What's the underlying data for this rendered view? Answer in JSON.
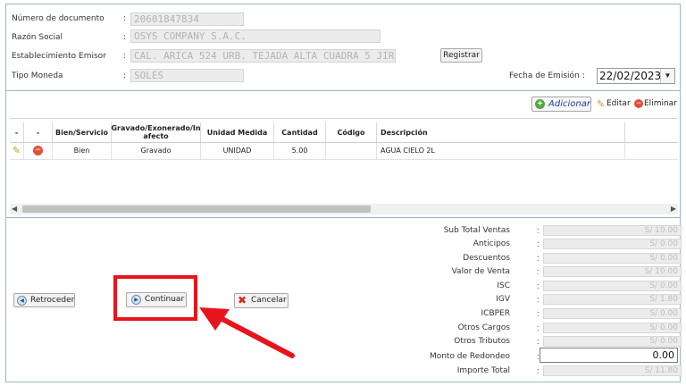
{
  "form": {
    "numero_label": "Número de documento",
    "numero_value": "20601847834",
    "razon_label": "Razón Social",
    "razon_value": "OSYS COMPANY S.A.C.",
    "establecimiento_label": "Establecimiento Emisor",
    "establecimiento_value": "CAL. ARICA 524 URB. TEJADA ALTA CUADRA 5 JIRON",
    "registrar_label": "Registrar",
    "moneda_label": "Tipo Moneda",
    "moneda_value": "SOLES",
    "fecha_label": "Fecha de Emisión",
    "fecha_value": "22/02/2023",
    "colon": ":"
  },
  "toolbar": {
    "adicionar_label": "Adicionar",
    "editar_label": "Editar",
    "eliminar_label": "Eliminar"
  },
  "table": {
    "headers": [
      "-",
      "-",
      "Bien/Servicio",
      "Gravado/Exonerado/In afecto",
      "Unidad Medida",
      "Cantidad",
      "Código",
      "Descripción"
    ],
    "rows": [
      {
        "bien_servicio": "Bien",
        "gravado": "Gravado",
        "unidad": "UNIDAD",
        "cantidad": "5.00",
        "codigo": "",
        "descripcion": "AGUA CIELO 2L"
      }
    ]
  },
  "actions": {
    "retroceder_label": "Retroceder",
    "continuar_label": "Continuar",
    "cancelar_label": "Cancelar"
  },
  "totals": [
    {
      "label": "Sub Total Ventas",
      "value": "S/ 10.00"
    },
    {
      "label": "Anticipos",
      "value": "S/ 0.00"
    },
    {
      "label": "Descuentos",
      "value": "S/ 0.00"
    },
    {
      "label": "Valor de Venta",
      "value": "S/ 10.00"
    },
    {
      "label": "ISC",
      "value": "S/ 0.00"
    },
    {
      "label": "IGV",
      "value": "S/ 1.80"
    },
    {
      "label": "ICBPER",
      "value": "S/ 0.00"
    },
    {
      "label": "Otros Cargos",
      "value": "S/ 0.00"
    },
    {
      "label": "Otros Tributos",
      "value": "S/ 0.00"
    },
    {
      "label": "Monto de Redondeo",
      "value": "0.00"
    },
    {
      "label": "Importe Total",
      "value": "S/ 11.80"
    }
  ],
  "colors": {
    "frame_border": "#9fb5c7",
    "highlight_red": "#e8141c",
    "adicionar_text": "#1a3fa8"
  }
}
